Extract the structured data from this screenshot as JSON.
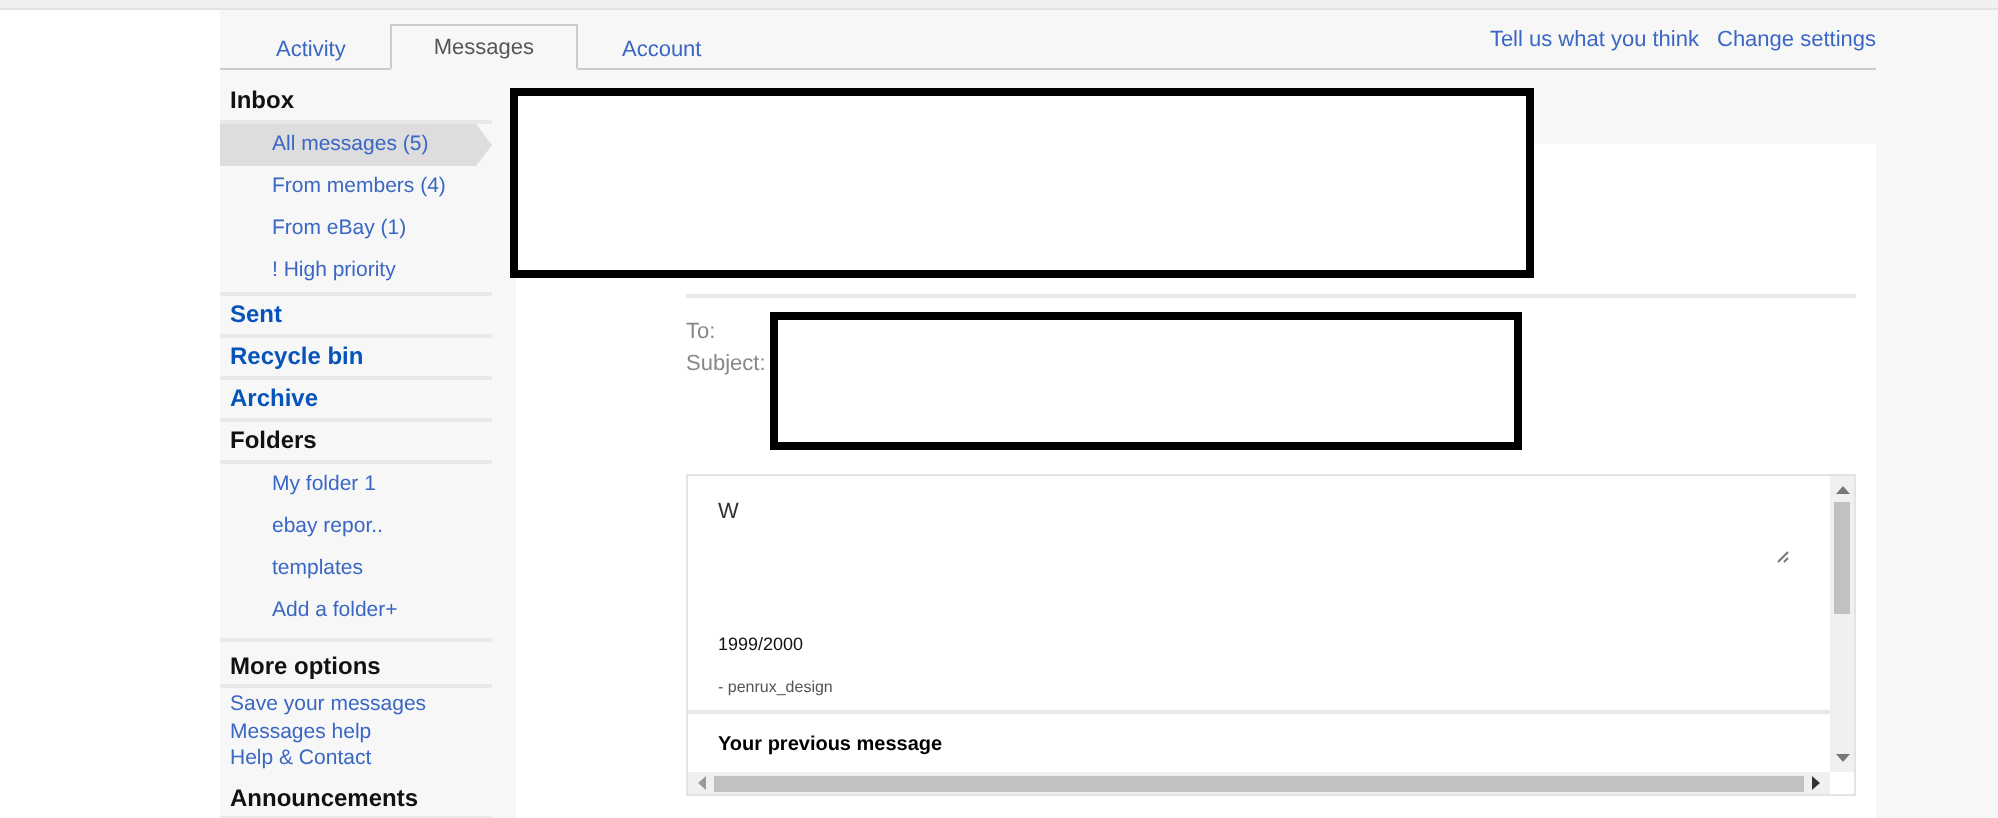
{
  "tabs": [
    {
      "label": "Activity",
      "selected": false
    },
    {
      "label": "Messages",
      "selected": true
    },
    {
      "label": "Account",
      "selected": false
    }
  ],
  "header_links": [
    "Tell us what you think",
    "Change settings"
  ],
  "sidebar": [
    {
      "kind": "group",
      "title": "Inbox",
      "items": [
        {
          "label": "All messages (5)",
          "selected": true
        },
        {
          "label": "From members (4)",
          "selected": false
        },
        {
          "label": "From eBay (1)",
          "selected": false
        },
        {
          "label": "! High priority",
          "selected": false
        }
      ]
    },
    {
      "kind": "link",
      "title": "Sent"
    },
    {
      "kind": "link",
      "title": "Recycle bin"
    },
    {
      "kind": "link",
      "title": "Archive"
    },
    {
      "kind": "group",
      "title": "Folders",
      "items": [
        {
          "label": "My folder 1",
          "selected": false
        },
        {
          "label": "ebay repor..",
          "selected": false
        },
        {
          "label": "templates",
          "selected": false
        },
        {
          "label": "Add a folder+",
          "selected": false
        }
      ]
    },
    {
      "kind": "options",
      "title": "More options",
      "items": [
        {
          "label": "Save your messages"
        },
        {
          "label": "Messages help"
        },
        {
          "label": "Help & Contact"
        }
      ]
    },
    {
      "kind": "options",
      "title": "Announcements"
    }
  ],
  "compose": {
    "to_label": "To:",
    "subject_label": "Subject:"
  },
  "message": {
    "body": "W",
    "signature_date": "1999/2000",
    "signature_name": "- penrux_design",
    "previous_heading": "Your previous message"
  }
}
